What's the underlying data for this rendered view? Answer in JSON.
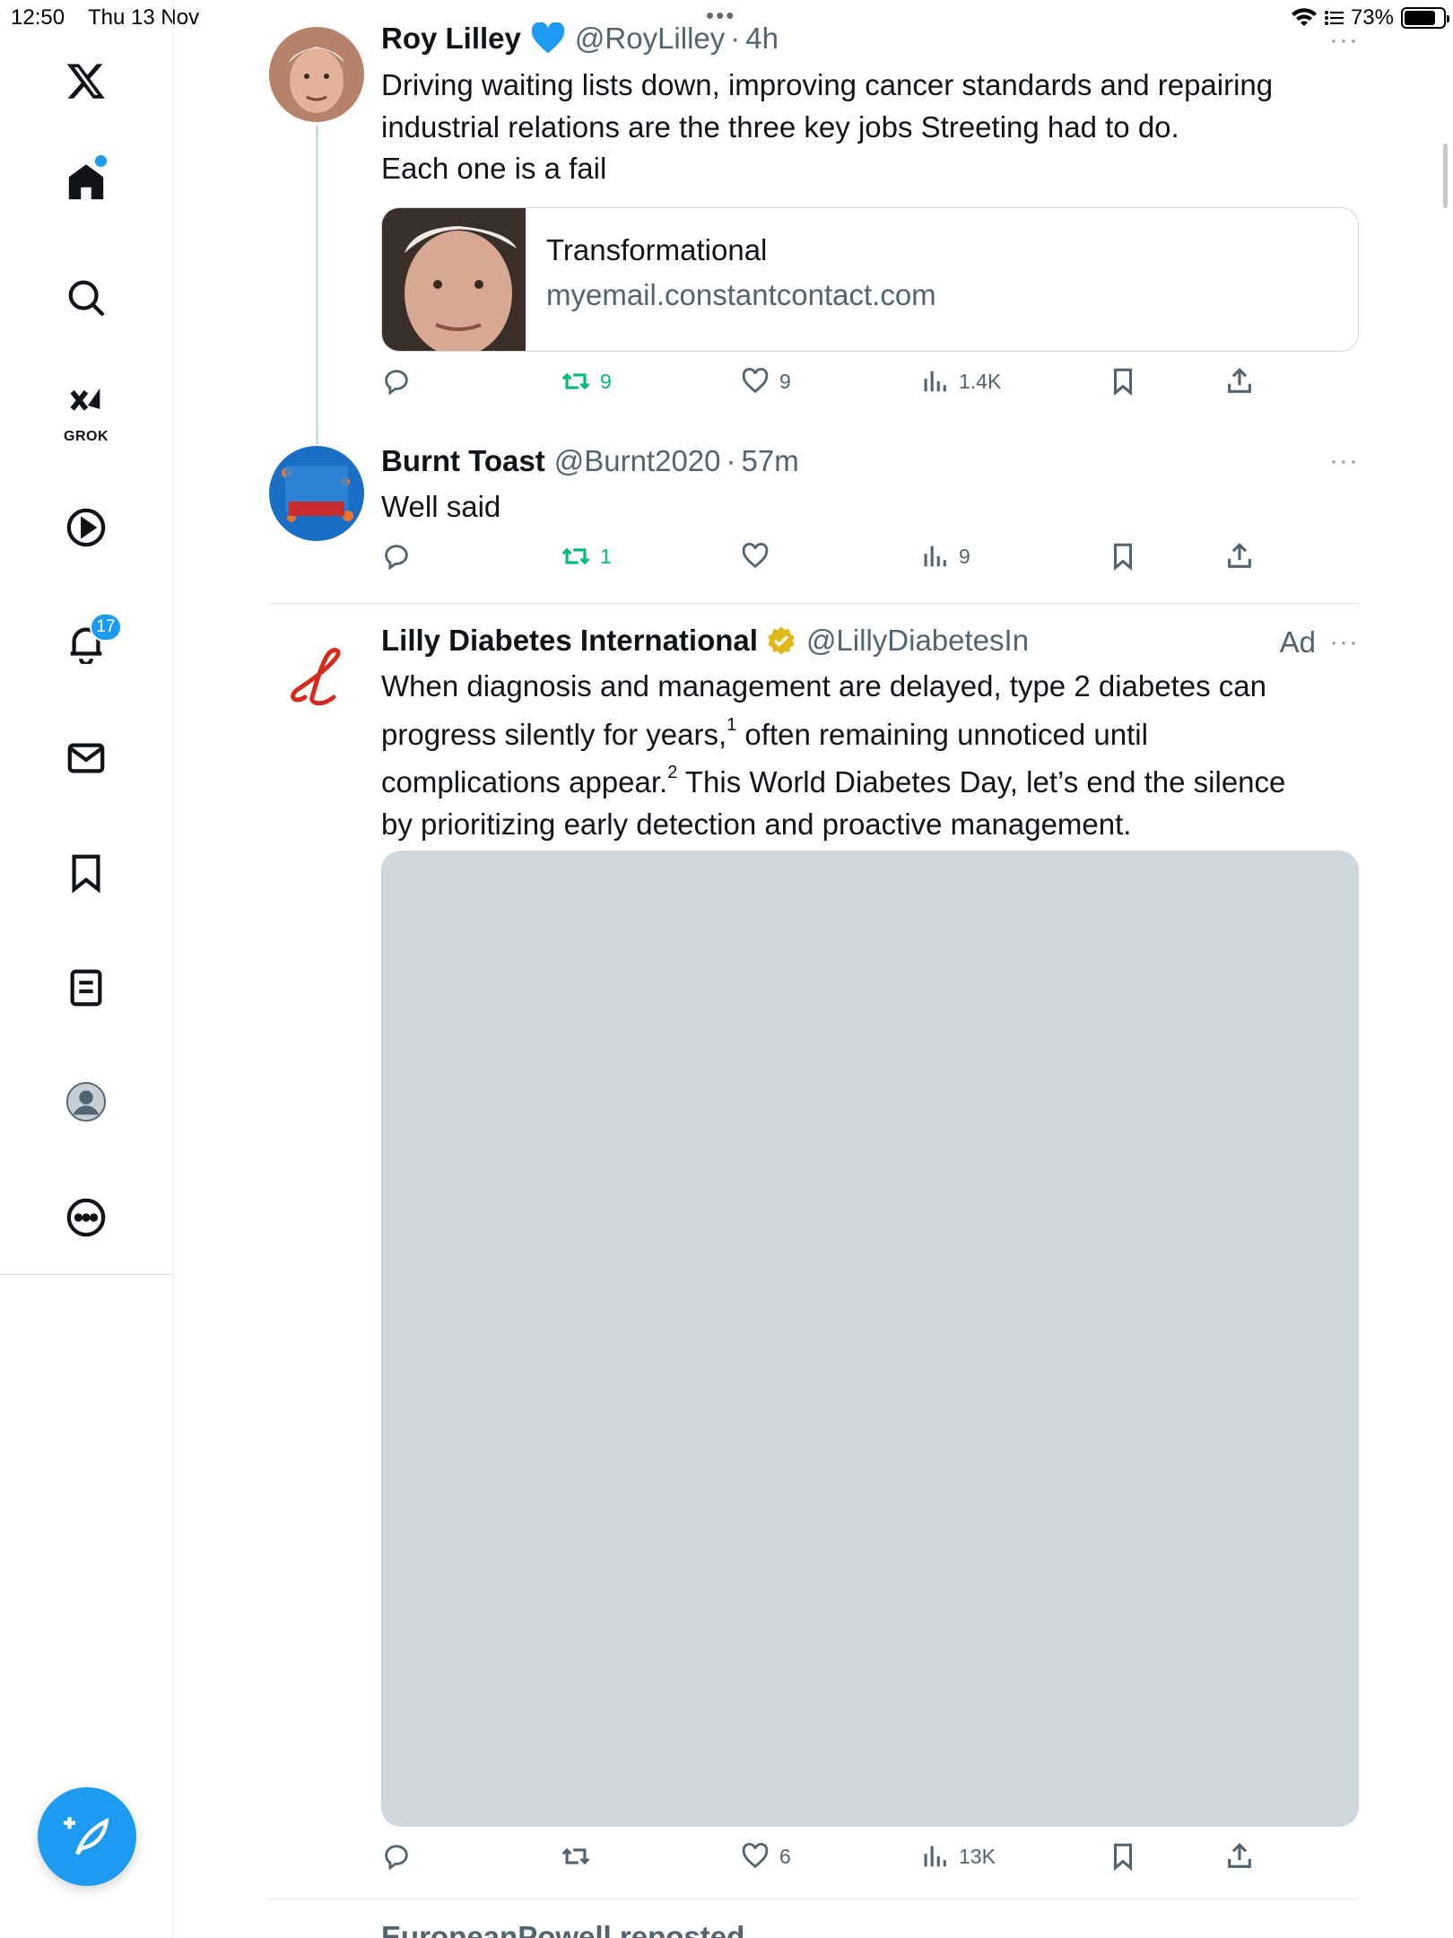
{
  "status_bar": {
    "time": "12:50",
    "date": "Thu 13 Nov",
    "battery": "73%"
  },
  "sidebar": {
    "grok_label": "GROK",
    "notifications_count": "17"
  },
  "tweets": [
    {
      "name": "Roy Lilley",
      "handle": "@RoyLilley",
      "time": "4h",
      "text_lines": [
        "Driving waiting lists down, improving cancer standards and repairing",
        "industrial relations are the three key jobs Streeting had to do.",
        "Each one is a fail"
      ],
      "card": {
        "title": "Transformational",
        "domain": "myemail.constantcontact.com"
      },
      "reposts": "9",
      "likes": "9",
      "views": "1.4K"
    },
    {
      "name": "Burnt Toast",
      "handle": "@Burnt2020",
      "time": "57m",
      "text": "Well said",
      "reposts": "1",
      "views": "9"
    },
    {
      "name": "Lilly Diabetes International",
      "handle": "@LillyDiabetesIn",
      "ad_label": "Ad",
      "text_a": "When diagnosis and management are delayed, type 2 diabetes can",
      "text_b": "progress silently for years,",
      "sup1": "1",
      "text_c": " often remaining unnoticed until",
      "text_d": "complications appear.",
      "sup2": "2",
      "text_e": " This World Diabetes Day, let’s end the silence",
      "text_f": "by prioritizing early detection and proactive management.",
      "likes": "6",
      "views": "13K"
    }
  ],
  "next_item_partial": "EuropeanPowell reposted",
  "colors": {
    "accent": "#1d9bf0",
    "repost_green": "#00ba7c",
    "secondary_text": "#536471",
    "lilly_red": "#d52b1e",
    "verified_gold": "#e2b719"
  }
}
